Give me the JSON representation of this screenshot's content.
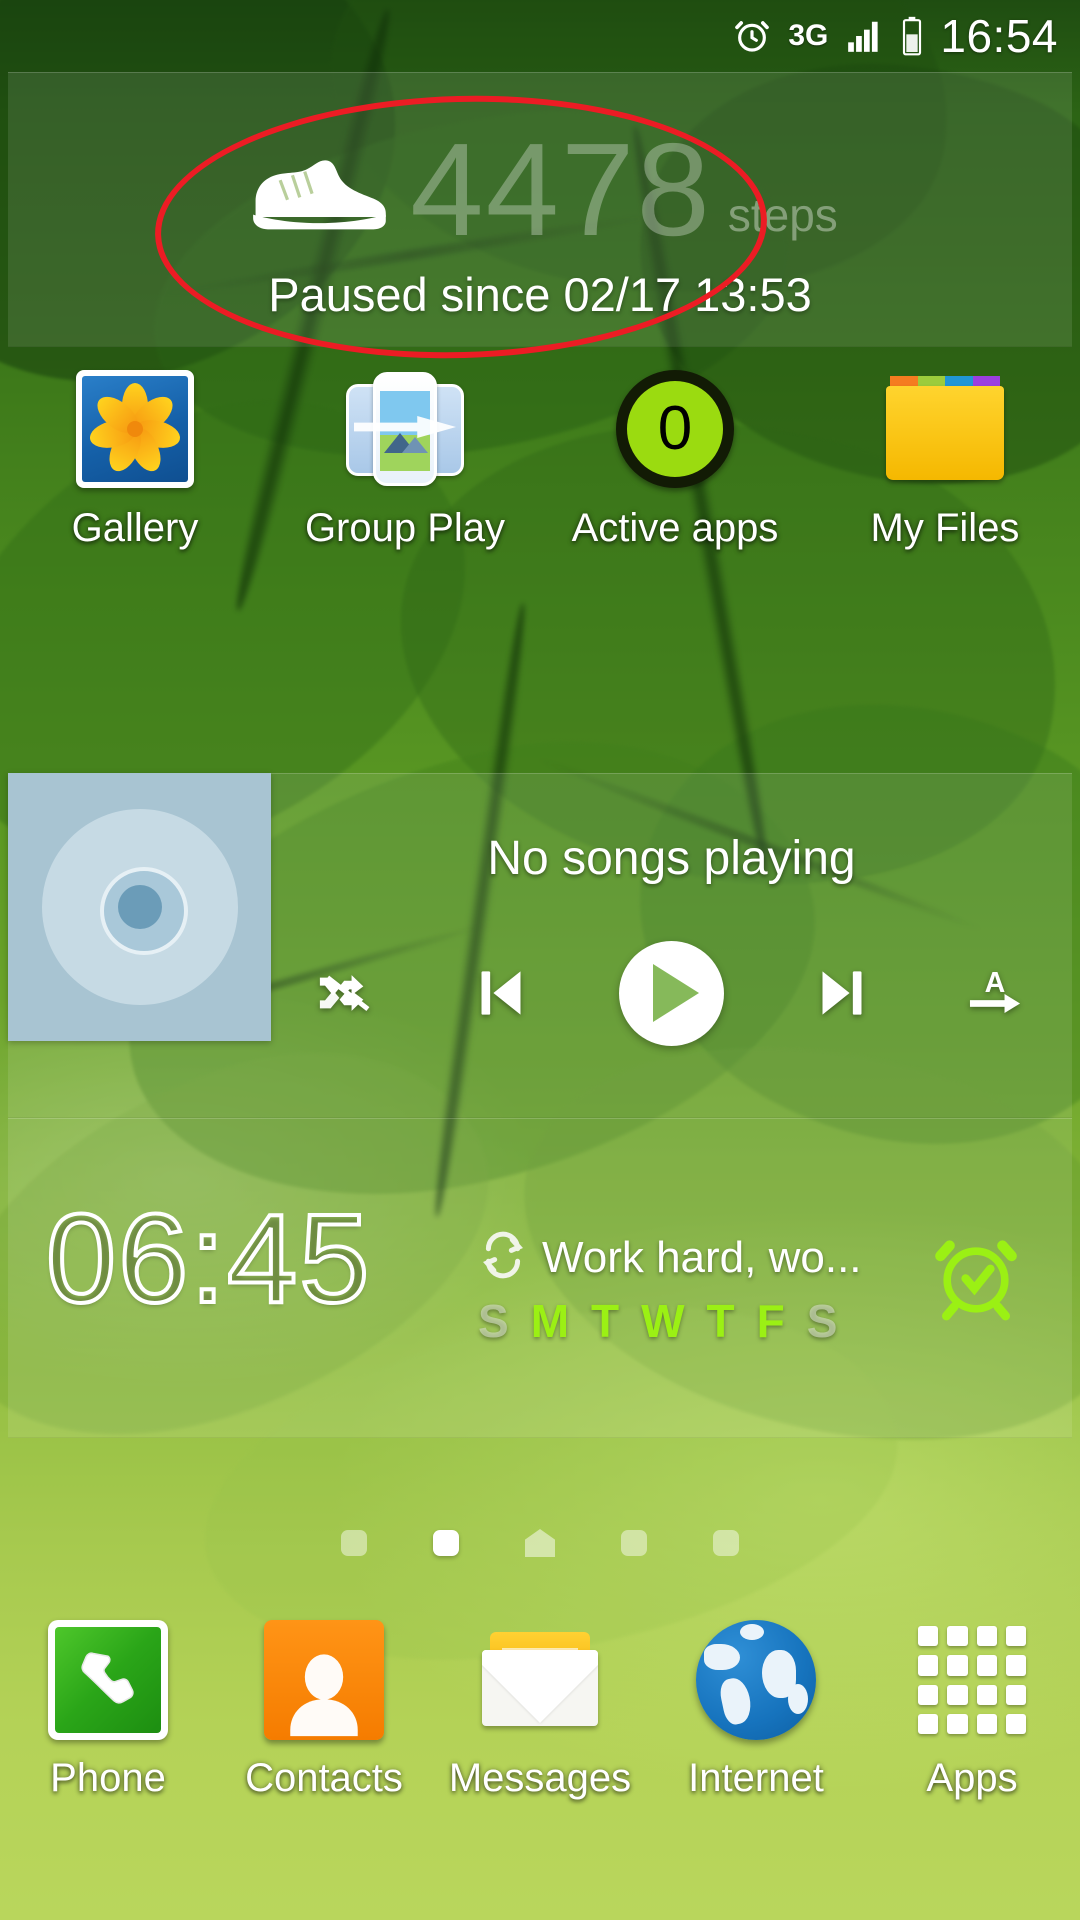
{
  "status_bar": {
    "alarm_icon": "alarm-clock-icon",
    "network": "3G",
    "signal_icon": "signal-bars-icon",
    "battery_icon": "battery-icon",
    "time": "16:54"
  },
  "pedometer_widget": {
    "icon": "running-shoe-icon",
    "steps": "4478",
    "unit": "steps",
    "status": "Paused since 02/17 13:53"
  },
  "annotation": {
    "shape": "ellipse",
    "color": "#ec1c24"
  },
  "app_row": [
    {
      "label": "Gallery",
      "icon": "gallery-icon"
    },
    {
      "label": "Group Play",
      "icon": "group-play-icon"
    },
    {
      "label": "Active apps",
      "icon": "active-apps-icon",
      "badge": "0"
    },
    {
      "label": "My Files",
      "icon": "my-files-folder-icon"
    }
  ],
  "music_widget": {
    "album_art_icon": "cd-disc-placeholder-icon",
    "title": "No songs playing",
    "controls": [
      {
        "name": "shuffle-off-icon",
        "label": "Shuffle off"
      },
      {
        "name": "previous-icon",
        "label": "Previous"
      },
      {
        "name": "play-icon",
        "label": "Play"
      },
      {
        "name": "next-icon",
        "label": "Next"
      },
      {
        "name": "repeat-all-icon",
        "label": "A"
      }
    ]
  },
  "clock_widget": {
    "alarm_time": "06:45",
    "repeat_icon": "repeat-icon",
    "alarm_label": "Work hard, wo...",
    "bell_icon": "alarm-clock-icon",
    "days": [
      {
        "letter": "S",
        "active": false
      },
      {
        "letter": "M",
        "active": true
      },
      {
        "letter": "T",
        "active": true
      },
      {
        "letter": "W",
        "active": true
      },
      {
        "letter": "T",
        "active": true
      },
      {
        "letter": "F",
        "active": true
      },
      {
        "letter": "S",
        "active": false
      }
    ],
    "active_day_color": "#9bf014",
    "inactive_day_color": "#d7e1c8"
  },
  "page_indicators": {
    "count": 5,
    "active_index": 1,
    "home_index": 2
  },
  "dock": [
    {
      "label": "Phone",
      "icon": "phone-icon"
    },
    {
      "label": "Contacts",
      "icon": "contacts-person-icon"
    },
    {
      "label": "Messages",
      "icon": "messages-envelope-icon"
    },
    {
      "label": "Internet",
      "icon": "globe-icon"
    },
    {
      "label": "Apps",
      "icon": "apps-grid-icon"
    }
  ]
}
